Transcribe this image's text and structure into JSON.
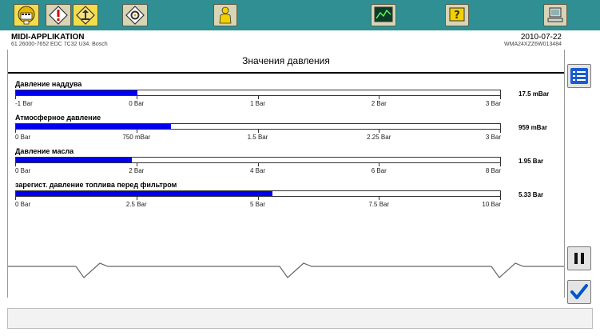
{
  "header": {
    "app_name": "MIDI-APPLIKATION",
    "app_sub": "61.26000-7652  EDC 7C32 U34. Bosch",
    "date": "2010-07-22",
    "vin": "WMA24XZZ6W013484"
  },
  "page_title": "Значения давления",
  "rows": [
    {
      "label": "Давление наддува",
      "value": "17.5 mBar",
      "fill_fraction": 0.25,
      "ticks": [
        "-1 Bar",
        "0 Bar",
        "1 Bar",
        "2 Bar",
        "3 Bar"
      ]
    },
    {
      "label": "Атмосферное давление",
      "value": "959 mBar",
      "fill_fraction": 0.32,
      "ticks": [
        "0 Bar",
        "750 mBar",
        "1.5 Bar",
        "2.25 Bar",
        "3 Bar"
      ]
    },
    {
      "label": "Давление масла",
      "value": "1.95 Bar",
      "fill_fraction": 0.24,
      "ticks": [
        "0 Bar",
        "2 Bar",
        "4 Bar",
        "6 Bar",
        "8 Bar"
      ]
    },
    {
      "label": "зарегист. давление топлива перед фильтром",
      "value": "5.33 Bar",
      "fill_fraction": 0.53,
      "ticks": [
        "0 Bar",
        "2.5 Bar",
        "5 Bar",
        "7.5 Bar",
        "10 Bar"
      ]
    }
  ],
  "toolbar": {
    "buttons": [
      {
        "name": "bus-button",
        "icon": "bus-icon",
        "active": true
      },
      {
        "name": "diagnose-button",
        "icon": "warning-diamond-icon",
        "active": false
      },
      {
        "name": "measure-button",
        "icon": "diamond-arrow-icon",
        "active": true
      },
      {
        "name": "settings-button",
        "icon": "gear-diamond-icon",
        "active": false
      },
      {
        "name": "person-button",
        "icon": "person-icon",
        "active": false
      },
      {
        "name": "chart-button",
        "icon": "line-chart-icon",
        "active": false
      },
      {
        "name": "help-button",
        "icon": "question-icon",
        "active": false
      },
      {
        "name": "computer-button",
        "icon": "computer-icon",
        "active": false
      }
    ]
  },
  "side": {
    "list_icon": "list-icon",
    "pause_icon": "pause-icon",
    "confirm_icon": "checkmark-icon"
  },
  "colors": {
    "toolbar": "#2f8f92",
    "bar_fill": "#0000ee",
    "confirm": "#0055cc"
  }
}
